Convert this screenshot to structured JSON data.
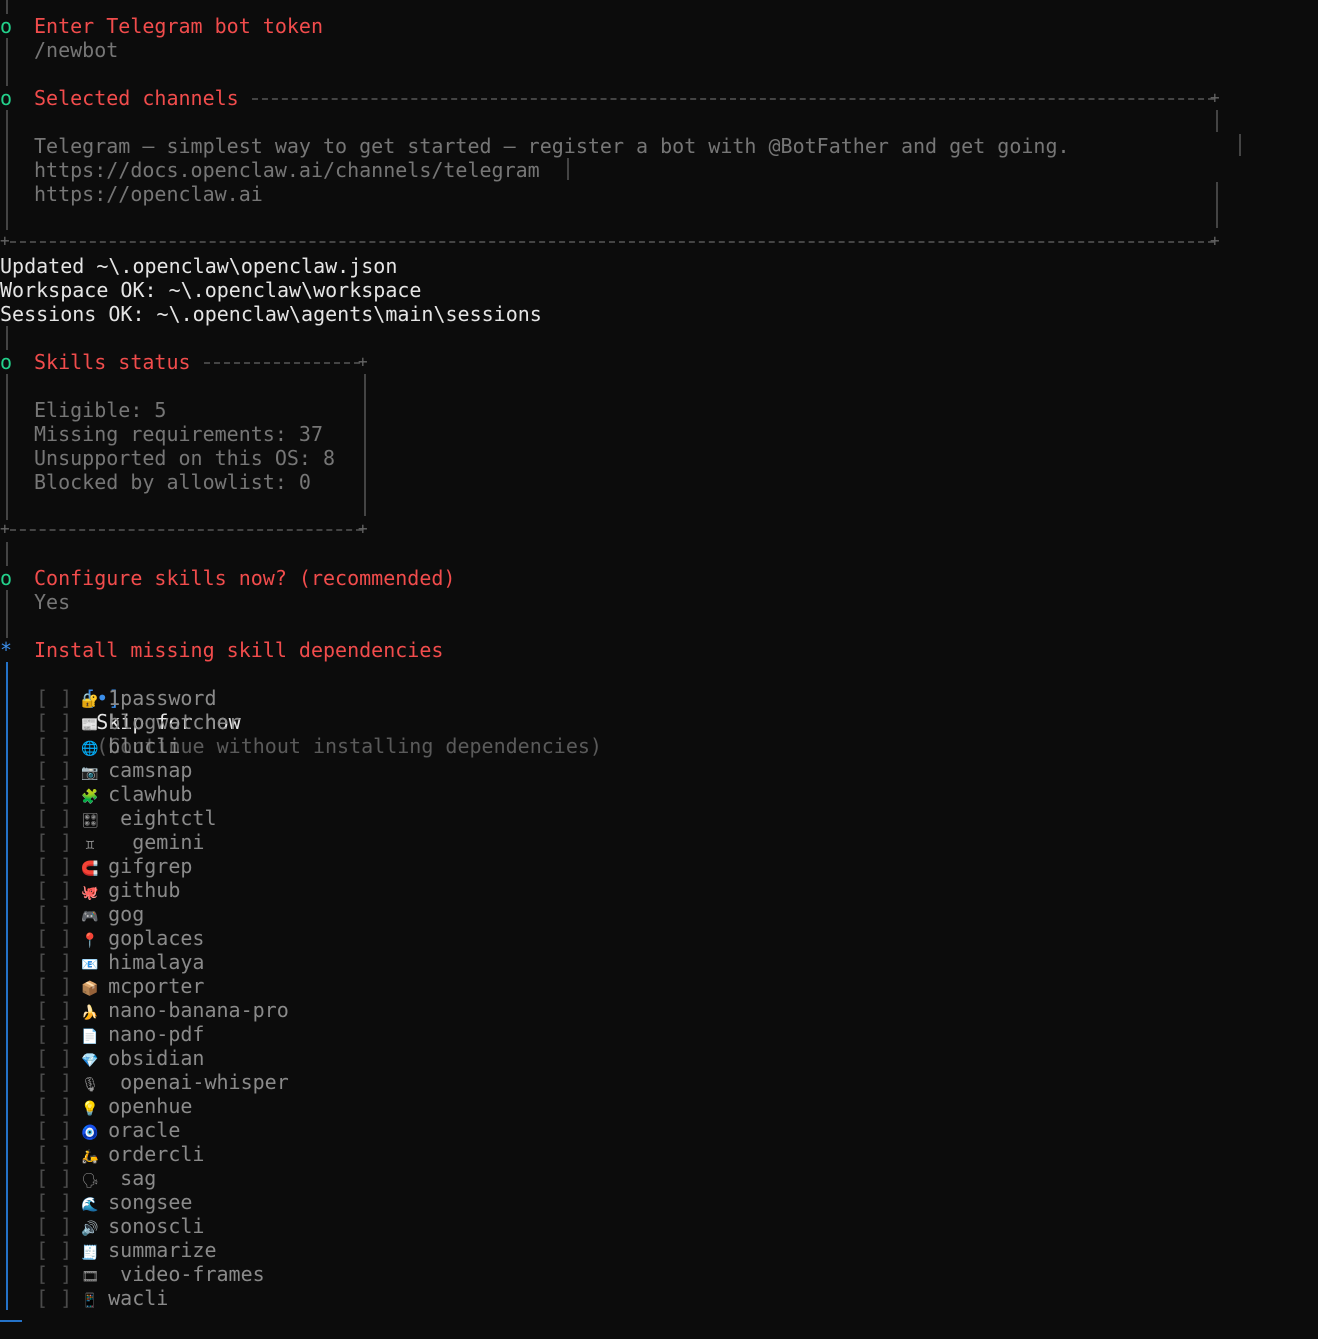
{
  "steps": {
    "telegram_token": {
      "marker": "o",
      "title": "Enter Telegram bot token",
      "value": "/newbot"
    },
    "channels": {
      "marker": "o",
      "title": "Selected channels",
      "lines": [
        "Telegram — simplest way to get started — register a bot with @BotFather and get going.",
        "https://docs.openclaw.ai/channels/telegram",
        "https://openclaw.ai"
      ]
    },
    "status_lines": [
      "Updated ~\\.openclaw\\openclaw.json",
      "Workspace OK: ~\\.openclaw\\workspace",
      "Sessions OK: ~\\.openclaw\\agents\\main\\sessions"
    ],
    "skills_status": {
      "marker": "o",
      "title": "Skills status",
      "lines": [
        "Eligible: 5",
        "Missing requirements: 37",
        "Unsupported on this OS: 8",
        "Blocked by allowlist: 0"
      ]
    },
    "configure": {
      "marker": "o",
      "title": "Configure skills now? (recommended)",
      "value": "Yes"
    },
    "install": {
      "marker": "*",
      "title": "Install missing skill dependencies",
      "skip": {
        "box": "[•]",
        "label": "Skip for now",
        "hint": "(Continue without installing dependencies)"
      },
      "options": [
        {
          "icon": "lock-icon",
          "glyph": "🔐",
          "label": "1password"
        },
        {
          "icon": "newspaper-icon",
          "glyph": "📰",
          "label": "blogwatcher"
        },
        {
          "icon": "globe-icon",
          "glyph": "🌐",
          "label": "blucli"
        },
        {
          "icon": "camera-icon",
          "glyph": "📷",
          "label": "camsnap"
        },
        {
          "icon": "puzzle-icon",
          "glyph": "🧩",
          "label": "clawhub"
        },
        {
          "icon": "dial-icon",
          "glyph": "🎛",
          "label": " eightctl"
        },
        {
          "icon": "gemini-icon",
          "glyph": "♊",
          "label": "  gemini"
        },
        {
          "icon": "magnet-icon",
          "glyph": "🧲",
          "label": "gifgrep"
        },
        {
          "icon": "octocat-icon",
          "glyph": "🐙",
          "label": "github"
        },
        {
          "icon": "gamepad-icon",
          "glyph": "🎮",
          "label": "gog"
        },
        {
          "icon": "pin-icon",
          "glyph": "📍",
          "label": "goplaces"
        },
        {
          "icon": "mail-icon",
          "glyph": "📧",
          "label": "himalaya"
        },
        {
          "icon": "package-icon",
          "glyph": "📦",
          "label": "mcporter"
        },
        {
          "icon": "banana-icon",
          "glyph": "🍌",
          "label": "nano-banana-pro"
        },
        {
          "icon": "document-icon",
          "glyph": "📄",
          "label": "nano-pdf"
        },
        {
          "icon": "gem-icon",
          "glyph": "💎",
          "label": "obsidian"
        },
        {
          "icon": "microphone-icon",
          "glyph": "🎙",
          "label": " openai-whisper"
        },
        {
          "icon": "bulb-icon",
          "glyph": "💡",
          "label": "openhue"
        },
        {
          "icon": "disc-icon",
          "glyph": "🧿",
          "label": "oracle"
        },
        {
          "icon": "scooter-icon",
          "glyph": "🛵",
          "label": "ordercli"
        },
        {
          "icon": "speech-icon",
          "glyph": "🗣",
          "label": " sag"
        },
        {
          "icon": "wave-icon",
          "glyph": "🌊",
          "label": "songsee"
        },
        {
          "icon": "speaker-icon",
          "glyph": "🔊",
          "label": "sonoscli"
        },
        {
          "icon": "receipt-icon",
          "glyph": "🧾",
          "label": "summarize"
        },
        {
          "icon": "film-icon",
          "glyph": "🎞",
          "label": " video-frames"
        },
        {
          "icon": "chat-icon",
          "glyph": "📱",
          "label": "wacli"
        }
      ]
    }
  },
  "colors": {
    "background": "#0c0c0c",
    "title": "#f14c4c",
    "marker_done": "#23d18b",
    "marker_active": "#3b8eea",
    "muted": "#767676"
  }
}
